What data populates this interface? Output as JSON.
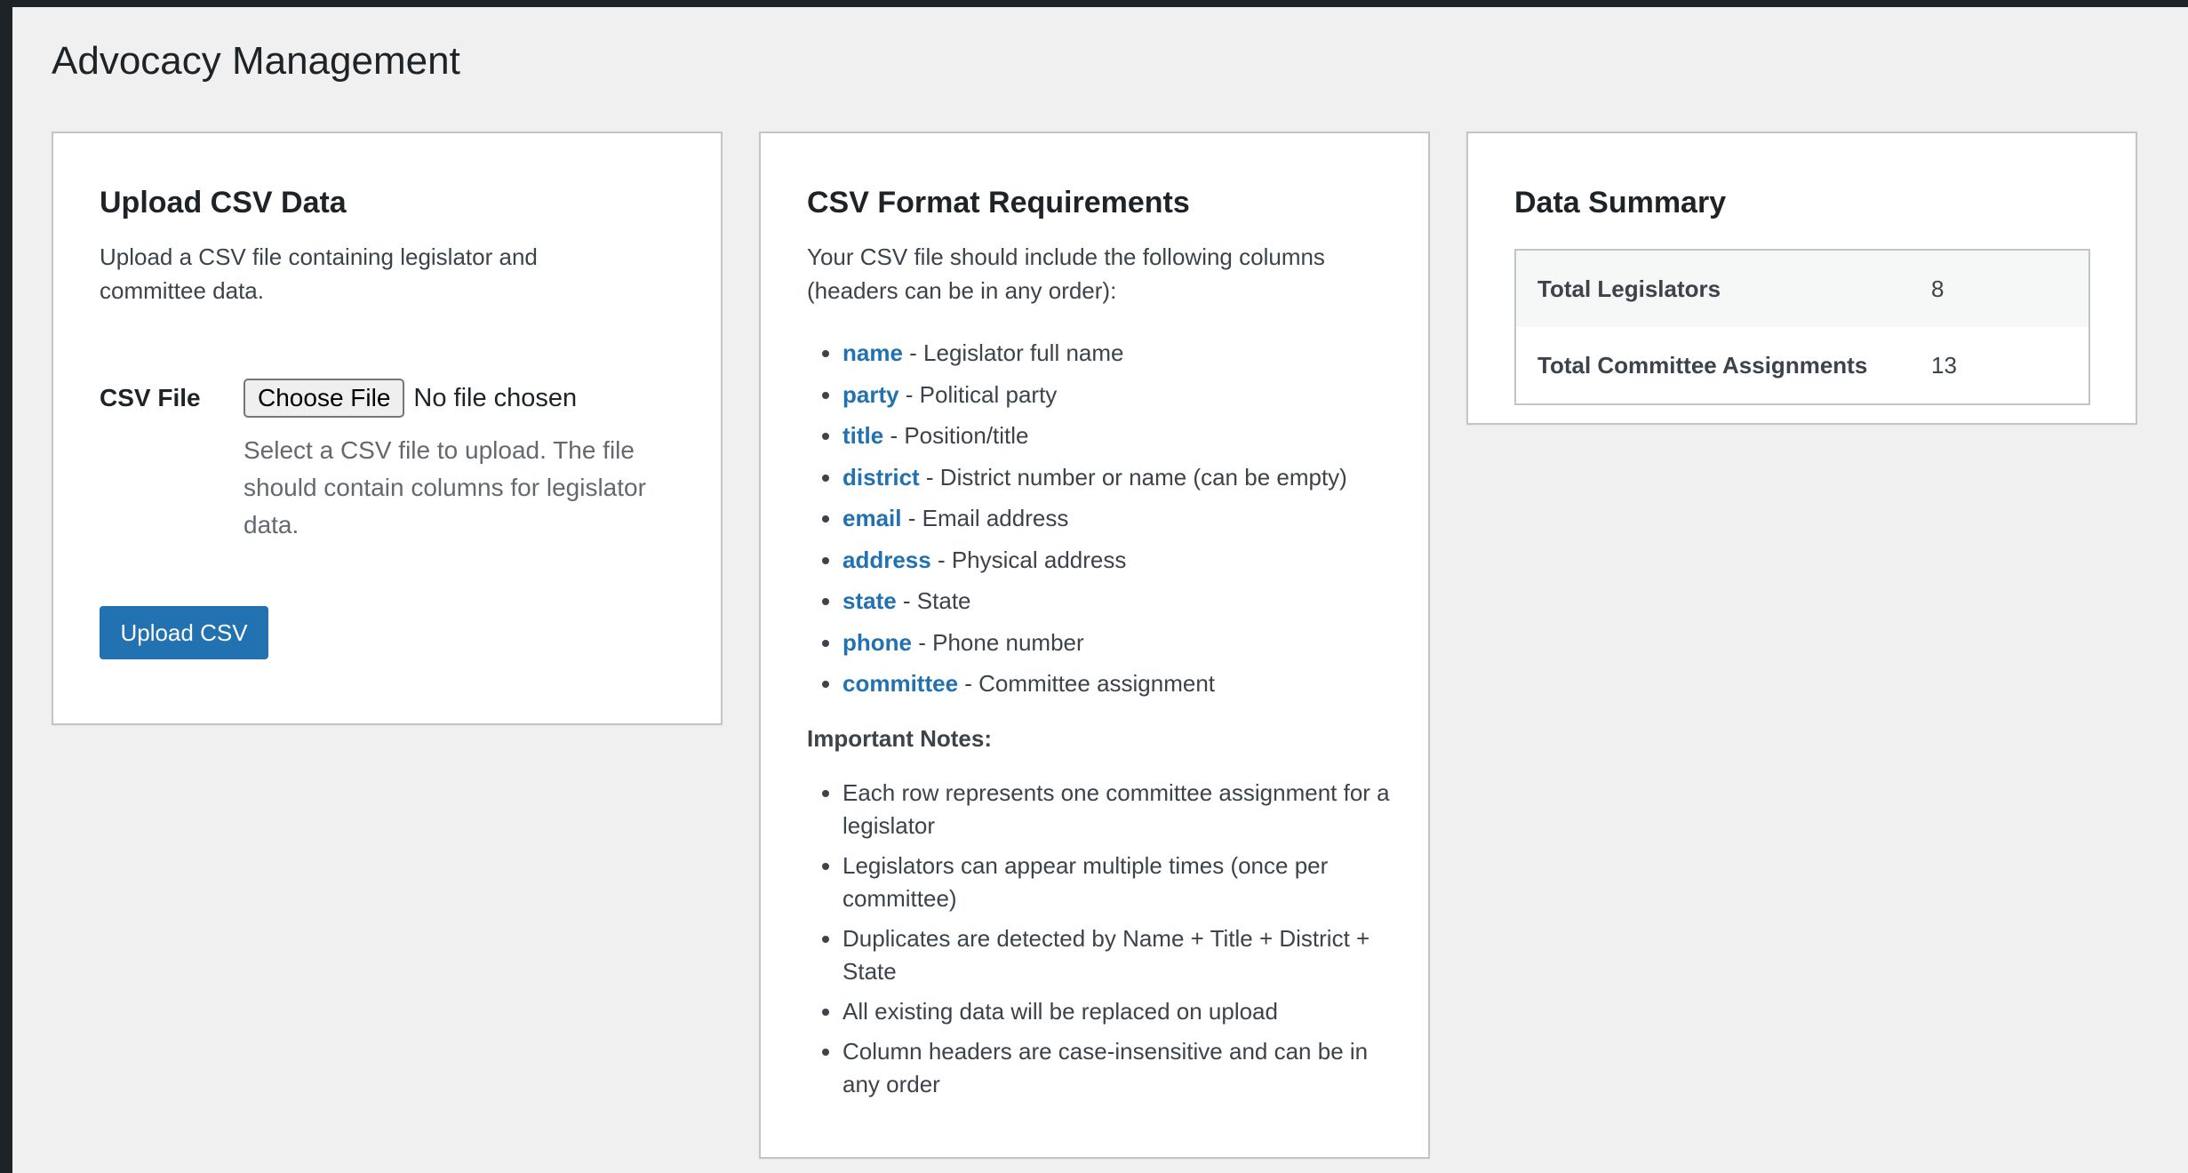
{
  "page": {
    "title": "Advocacy Management"
  },
  "upload_card": {
    "title": "Upload CSV Data",
    "description": "Upload a CSV file containing legislator and committee data.",
    "field_label": "CSV File",
    "choose_file_label": "Choose File",
    "file_status": "No file chosen",
    "help_text": "Select a CSV file to upload. The file should contain columns for legislator data.",
    "submit_label": "Upload CSV"
  },
  "format_card": {
    "title": "CSV Format Requirements",
    "intro": "Your CSV file should include the following columns (headers can be in any order):",
    "columns": [
      {
        "name": "name",
        "description": " - Legislator full name"
      },
      {
        "name": "party",
        "description": " - Political party"
      },
      {
        "name": "title",
        "description": " - Position/title"
      },
      {
        "name": "district",
        "description": " - District number or name (can be empty)"
      },
      {
        "name": "email",
        "description": " - Email address"
      },
      {
        "name": "address",
        "description": " - Physical address"
      },
      {
        "name": "state",
        "description": " - State"
      },
      {
        "name": "phone",
        "description": " - Phone number"
      },
      {
        "name": "committee",
        "description": " - Committee assignment"
      }
    ],
    "notes_title": "Important Notes:",
    "notes": [
      "Each row represents one committee assignment for a legislator",
      "Legislators can appear multiple times (once per committee)",
      "Duplicates are detected by Name + Title + District + State",
      "All existing data will be replaced on upload",
      "Column headers are case-insensitive and can be in any order"
    ]
  },
  "summary_card": {
    "title": "Data Summary",
    "rows": [
      {
        "label": "Total Legislators",
        "value": "8"
      },
      {
        "label": "Total Committee Assignments",
        "value": "13"
      }
    ]
  },
  "colors": {
    "accent": "#2271b1",
    "background": "#f0f0f1",
    "sidebar": "#1d2327"
  }
}
